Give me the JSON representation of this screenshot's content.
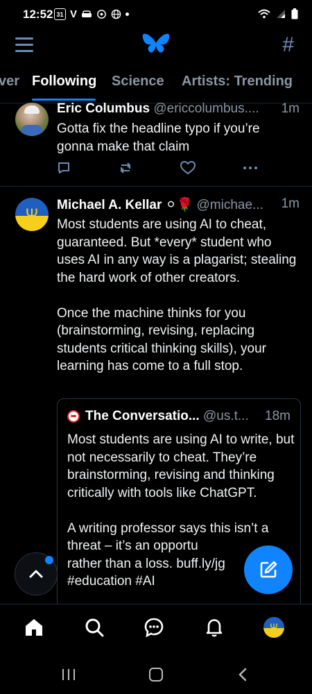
{
  "status_bar": {
    "time": "12:52",
    "calendar_badge": "31",
    "v_icon": "V"
  },
  "tabs": [
    {
      "label": "ver"
    },
    {
      "label": "Following"
    },
    {
      "label": "Science"
    },
    {
      "label": "Artists: Trending"
    }
  ],
  "post1": {
    "author": "Eric Columbus",
    "handle": "@ericcolumbus....",
    "time": "1m",
    "text": "Gotta fix the headline typo if you’re gonna make that claim"
  },
  "post2": {
    "author": "Michael A. Kellar",
    "emoji": "⚪🌹",
    "handle": "@michae...",
    "time": "1m",
    "text": "Most students are using AI to cheat, guaranteed.  But *every* student who uses AI in any way is a plagarist; stealing the hard work of other creators.\n\nOnce the machine thinks for you (brainstorming, revising, replacing students critical thinking skills), your learning has come to a full stop.",
    "quote": {
      "author": "The Conversatio...",
      "handle": "@us.t...",
      "time": "18m",
      "text": "Most students are using AI to write, but not necessarily to cheat. They’re brainstorming, revising and thinking critically with tools like ChatGPT.\n\nA writing professor says this isn’t a threat – it’s an opportu\nrather than a loss. buff.ly/jg\n#education #AI"
    }
  },
  "colors": {
    "accent": "#1083fe",
    "muted": "#8a96a3",
    "icon": "#6b8db5"
  }
}
